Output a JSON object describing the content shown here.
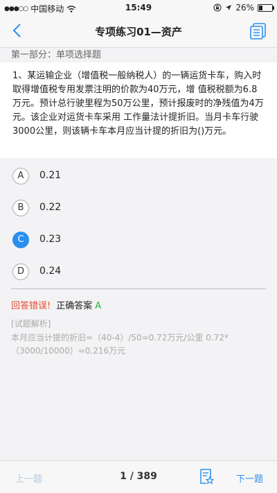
{
  "status_bar": {
    "signal": "●●●○○",
    "carrier": "中国移动",
    "time": "15:49",
    "battery_text": "26%",
    "battery_level": 0.26
  },
  "navbar": {
    "title": "专项练习01—资产"
  },
  "section_title": "第一部分：单项选择题",
  "question": {
    "text": "1、某运输企业（增值税一般纳税人）的一辆运货卡车，购入时取得增值税专用发票注明的价款为40万元，增 值税税额为6.8万元。预计总行驶里程为50万公里，预计报废时的净残值为4万元。该企业对运货卡车采用 工作量法计提折旧。当月卡车行驶3000公里，则该辆卡车本月应当计提的折旧为()万元。"
  },
  "options": [
    {
      "letter": "A",
      "text": "0.21"
    },
    {
      "letter": "B",
      "text": "0.22"
    },
    {
      "letter": "C",
      "text": "0.23"
    },
    {
      "letter": "D",
      "text": "0.24"
    }
  ],
  "result": {
    "wrong_label": "回答错误!",
    "correct_label": "正确答案",
    "correct_value": "A"
  },
  "explanation": {
    "heading": "[试题解析]",
    "text": "本月应当计提的折旧=（40-4）/50=0.72万元/公里 0.72*（3000/10000）=0.216万元"
  },
  "footer": {
    "prev_label": "上一题",
    "page": "1 / 389",
    "next_label": "下一题"
  },
  "colors": {
    "accent": "#2a8ff0",
    "error": "#e64a2e",
    "success": "#2bb53c"
  }
}
